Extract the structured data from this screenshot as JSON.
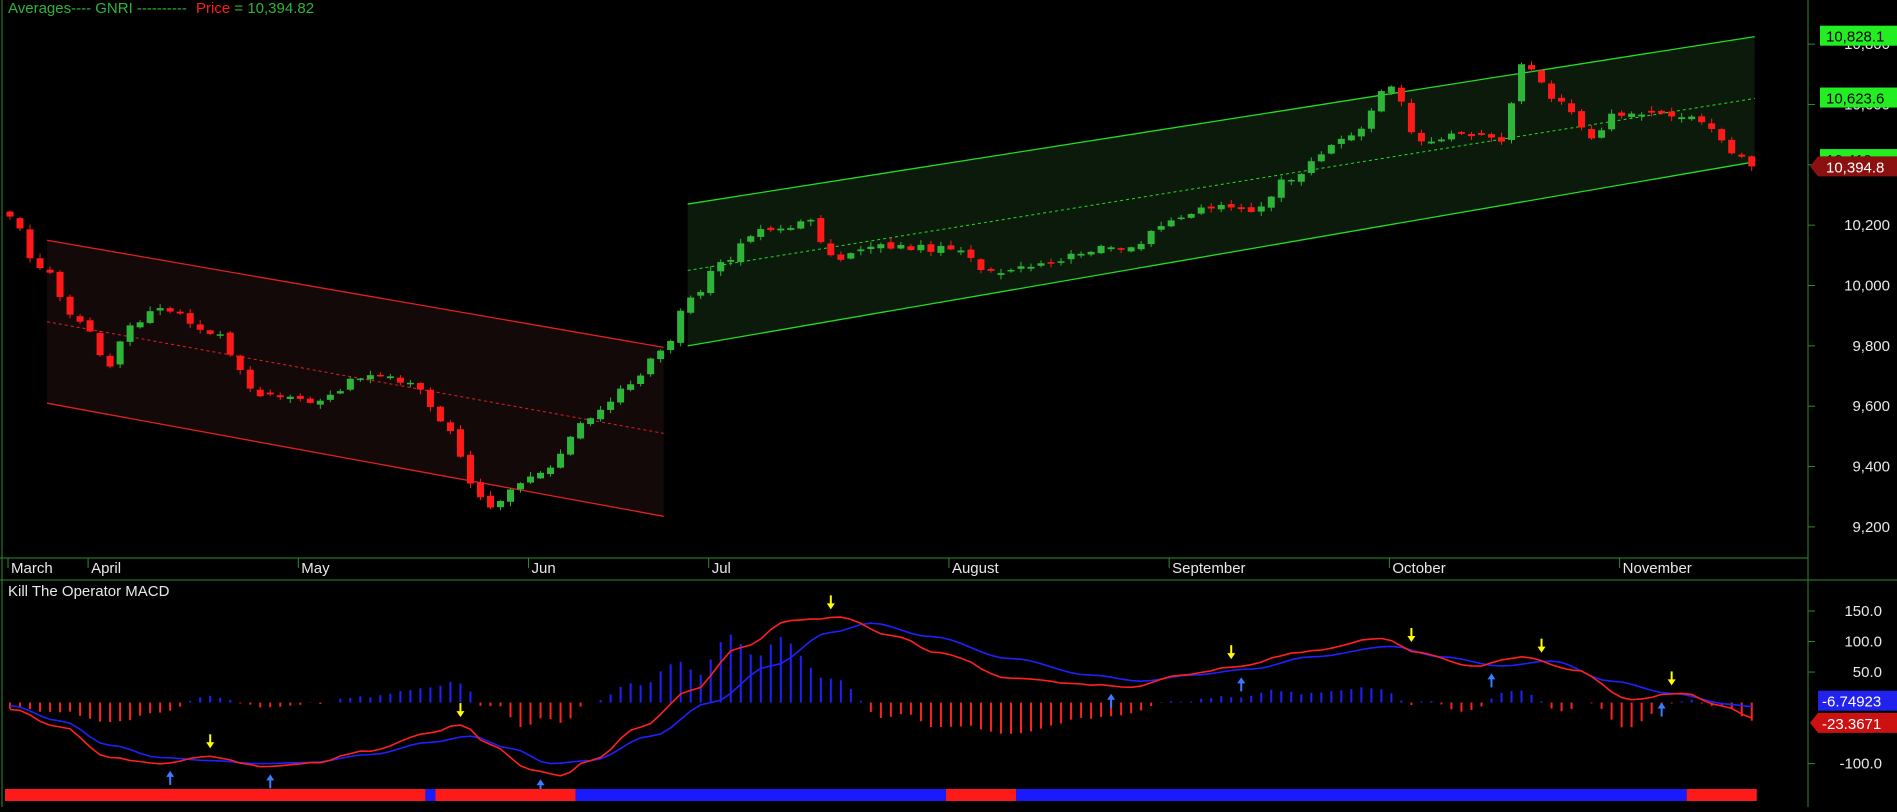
{
  "colors": {
    "background": "#000000",
    "up": "#2fb43a",
    "down": "#ff1a1a",
    "axis": "#2e8b2e",
    "label": "#e8e8e8",
    "bull_channel": "#22dd22",
    "bear_channel": "#e02020",
    "macd_line": "#ff2020",
    "signal_line": "#2020ff",
    "arrow_down": "#ffff00",
    "arrow_up": "#3a7bff"
  },
  "header": {
    "prefix": "Averages---- GNRI ----------",
    "price_label": "Price",
    "price_eq": " = 10,394.82"
  },
  "macd_title": "Kill The Operator MACD",
  "chart_data": [
    {
      "type": "candlestick",
      "symbol": "GNRI",
      "ylim": [
        9130,
        10880
      ],
      "y_ticks": [
        9200,
        9400,
        9600,
        9800,
        10000,
        10200,
        10400,
        10600,
        10800
      ],
      "y_tick_labels": [
        "9,200",
        "9,400",
        "9,600",
        "9,800",
        "10,000",
        "10,200",
        "10,400",
        "10,600",
        "10,800"
      ],
      "months": [
        "March",
        "April",
        "May",
        "Jun",
        "Jul",
        "August",
        "September",
        "October",
        "November"
      ],
      "month_start_index": [
        0,
        8,
        29,
        52,
        70,
        94,
        116,
        138,
        161
      ],
      "num_bars": 175,
      "closes_anchor": [
        [
          0,
          10220
        ],
        [
          3,
          10060
        ],
        [
          7,
          9880
        ],
        [
          10,
          9740
        ],
        [
          12,
          9870
        ],
        [
          15,
          9930
        ],
        [
          20,
          9850
        ],
        [
          25,
          9640
        ],
        [
          30,
          9620
        ],
        [
          36,
          9700
        ],
        [
          40,
          9680
        ],
        [
          44,
          9520
        ],
        [
          46,
          9350
        ],
        [
          48,
          9260
        ],
        [
          50,
          9330
        ],
        [
          53,
          9370
        ],
        [
          58,
          9560
        ],
        [
          62,
          9680
        ],
        [
          65,
          9780
        ],
        [
          68,
          9950
        ],
        [
          71,
          10080
        ],
        [
          75,
          10180
        ],
        [
          80,
          10210
        ],
        [
          82,
          10090
        ],
        [
          87,
          10130
        ],
        [
          94,
          10120
        ],
        [
          98,
          10050
        ],
        [
          104,
          10080
        ],
        [
          108,
          10120
        ],
        [
          112,
          10130
        ],
        [
          115,
          10200
        ],
        [
          120,
          10260
        ],
        [
          124,
          10250
        ],
        [
          128,
          10360
        ],
        [
          131,
          10440
        ],
        [
          134,
          10500
        ],
        [
          138,
          10660
        ],
        [
          141,
          10470
        ],
        [
          145,
          10500
        ],
        [
          149,
          10480
        ],
        [
          151,
          10730
        ],
        [
          155,
          10600
        ],
        [
          158,
          10490
        ],
        [
          160,
          10560
        ],
        [
          163,
          10570
        ],
        [
          167,
          10560
        ],
        [
          170,
          10530
        ],
        [
          172,
          10440
        ],
        [
          174,
          10394.82
        ]
      ],
      "badges": [
        {
          "label": "10,828.1",
          "value": 10828,
          "color": "#22ee22"
        },
        {
          "label": "10,623.6",
          "value": 10623,
          "color": "#22ee22"
        },
        {
          "label": "10,419",
          "value": 10419,
          "color": "#22ee22"
        },
        {
          "label": "10,394.8",
          "value": 10394.82,
          "color": "#8b1010"
        }
      ],
      "channels": [
        {
          "name": "bear",
          "start": 4,
          "end": 65,
          "upper": [
            10150,
            9795
          ],
          "mid": [
            9880,
            9510
          ],
          "lower": [
            9610,
            9235
          ]
        },
        {
          "name": "bull",
          "start": 68,
          "end": 174,
          "upper": [
            10270,
            10825
          ],
          "mid": [
            10050,
            10620
          ],
          "lower": [
            9800,
            10410
          ]
        }
      ]
    },
    {
      "type": "line",
      "title": "Kill The Operator MACD",
      "ylim": [
        -135,
        168
      ],
      "y_ticks": [
        150,
        100,
        50,
        -100
      ],
      "y_tick_labels": [
        "150.0",
        "100.0",
        "50.0",
        "-100.0"
      ],
      "minus_label": "-100.0",
      "badges": [
        {
          "label": "-6.74923",
          "value": -6.75,
          "color": "#2222ee"
        },
        {
          "label": "-23.3671",
          "value": -23.37,
          "color": "#cc1111"
        }
      ],
      "macd_anchor": [
        [
          0,
          -10
        ],
        [
          5,
          -40
        ],
        [
          10,
          -90
        ],
        [
          15,
          -100
        ],
        [
          20,
          -88
        ],
        [
          25,
          -105
        ],
        [
          30,
          -100
        ],
        [
          36,
          -78
        ],
        [
          42,
          -50
        ],
        [
          45,
          -35
        ],
        [
          48,
          -70
        ],
        [
          52,
          -110
        ],
        [
          55,
          -120
        ],
        [
          58,
          -95
        ],
        [
          63,
          -40
        ],
        [
          68,
          20
        ],
        [
          73,
          90
        ],
        [
          78,
          135
        ],
        [
          83,
          140
        ],
        [
          88,
          110
        ],
        [
          93,
          80
        ],
        [
          100,
          40
        ],
        [
          108,
          30
        ],
        [
          112,
          25
        ],
        [
          117,
          45
        ],
        [
          122,
          58
        ],
        [
          130,
          85
        ],
        [
          137,
          105
        ],
        [
          141,
          80
        ],
        [
          146,
          60
        ],
        [
          151,
          75
        ],
        [
          156,
          55
        ],
        [
          162,
          5
        ],
        [
          167,
          15
        ],
        [
          171,
          -5
        ],
        [
          174,
          -23.37
        ]
      ],
      "signal_anchor": [
        [
          0,
          -5
        ],
        [
          5,
          -30
        ],
        [
          10,
          -70
        ],
        [
          15,
          -90
        ],
        [
          20,
          -95
        ],
        [
          25,
          -100
        ],
        [
          30,
          -98
        ],
        [
          36,
          -85
        ],
        [
          42,
          -65
        ],
        [
          46,
          -55
        ],
        [
          50,
          -75
        ],
        [
          54,
          -100
        ],
        [
          58,
          -95
        ],
        [
          64,
          -55
        ],
        [
          70,
          0
        ],
        [
          76,
          60
        ],
        [
          82,
          115
        ],
        [
          86,
          130
        ],
        [
          92,
          108
        ],
        [
          100,
          72
        ],
        [
          108,
          45
        ],
        [
          113,
          35
        ],
        [
          118,
          45
        ],
        [
          124,
          55
        ],
        [
          130,
          75
        ],
        [
          138,
          92
        ],
        [
          143,
          75
        ],
        [
          149,
          60
        ],
        [
          154,
          68
        ],
        [
          160,
          35
        ],
        [
          166,
          15
        ],
        [
          172,
          -3
        ],
        [
          174,
          -6.75
        ]
      ],
      "sell_arrows": [
        20,
        45,
        82,
        122,
        140,
        153,
        166
      ],
      "buy_arrows": [
        16,
        26,
        53,
        110,
        123,
        148,
        165
      ],
      "strip": [
        {
          "start": 0,
          "end": 42,
          "color": "#ff1a1a"
        },
        {
          "start": 42,
          "end": 43,
          "color": "#1a1aff"
        },
        {
          "start": 43,
          "end": 57,
          "color": "#ff1a1a"
        },
        {
          "start": 57,
          "end": 94,
          "color": "#1a1aff"
        },
        {
          "start": 94,
          "end": 101,
          "color": "#ff1a1a"
        },
        {
          "start": 101,
          "end": 168,
          "color": "#1a1aff"
        },
        {
          "start": 168,
          "end": 175,
          "color": "#ff1a1a"
        }
      ]
    }
  ]
}
